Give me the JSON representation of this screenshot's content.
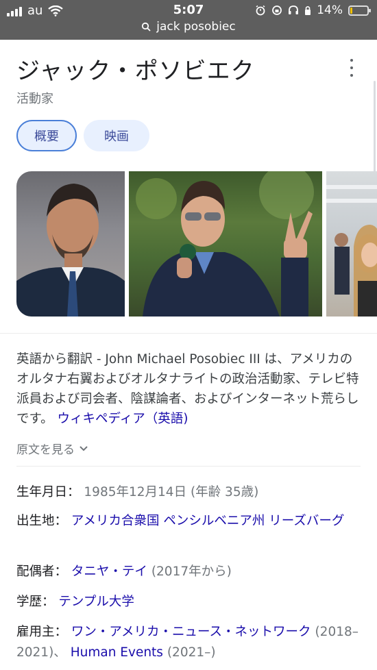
{
  "status_bar": {
    "carrier": "au",
    "time": "5:07",
    "url": "jack posobiec",
    "battery": "14%",
    "battery_level": 0.14
  },
  "header": {
    "title": "ジャック・ポソビエク",
    "subtitle": "活動家"
  },
  "tabs": [
    {
      "label": "概要"
    },
    {
      "label": "映画"
    }
  ],
  "description": {
    "text": "英語から翻訳 - John Michael Posobiec III は、アメリカのオルタナ右翼およびオルタナライトの政治活動家、テレビ特派員および司会者、陰謀論者、およびインターネット荒らしです。 ",
    "source_link": "ウィキペディア（英語)",
    "see_original": "原文を見る"
  },
  "facts": {
    "born": {
      "label": "生年月日：",
      "value": "1985年12月14日 (年齢 35歳)"
    },
    "birthplace": {
      "label": "出生地：",
      "link": "アメリカ合衆国 ペンシルベニア州 リーズバーグ"
    },
    "spouse": {
      "label": "配偶者：",
      "link": "タニヤ・テイ",
      "value": "(2017年から)"
    },
    "education": {
      "label": "学歴：",
      "link": "テンプル大学"
    },
    "employer": {
      "label": "雇用主：",
      "link1": "ワン・アメリカ・ニュース・ネットワーク",
      "value1": "(2018–2021)、",
      "link2": "Human Events",
      "value2": "(2021–)"
    }
  },
  "icons": {
    "lock": "lock-icon",
    "search": "search-icon",
    "wifi": "wifi-icon",
    "alarm": "alarm-icon",
    "headphones": "headphones-icon",
    "chevron": "chevron-down-icon",
    "more": "more-vert-icon"
  },
  "colors": {
    "link": "#1a0dab",
    "status_bar": "#5e5e5e",
    "chip_bg": "#e8f0fe",
    "battery_fill": "#f2c200"
  }
}
